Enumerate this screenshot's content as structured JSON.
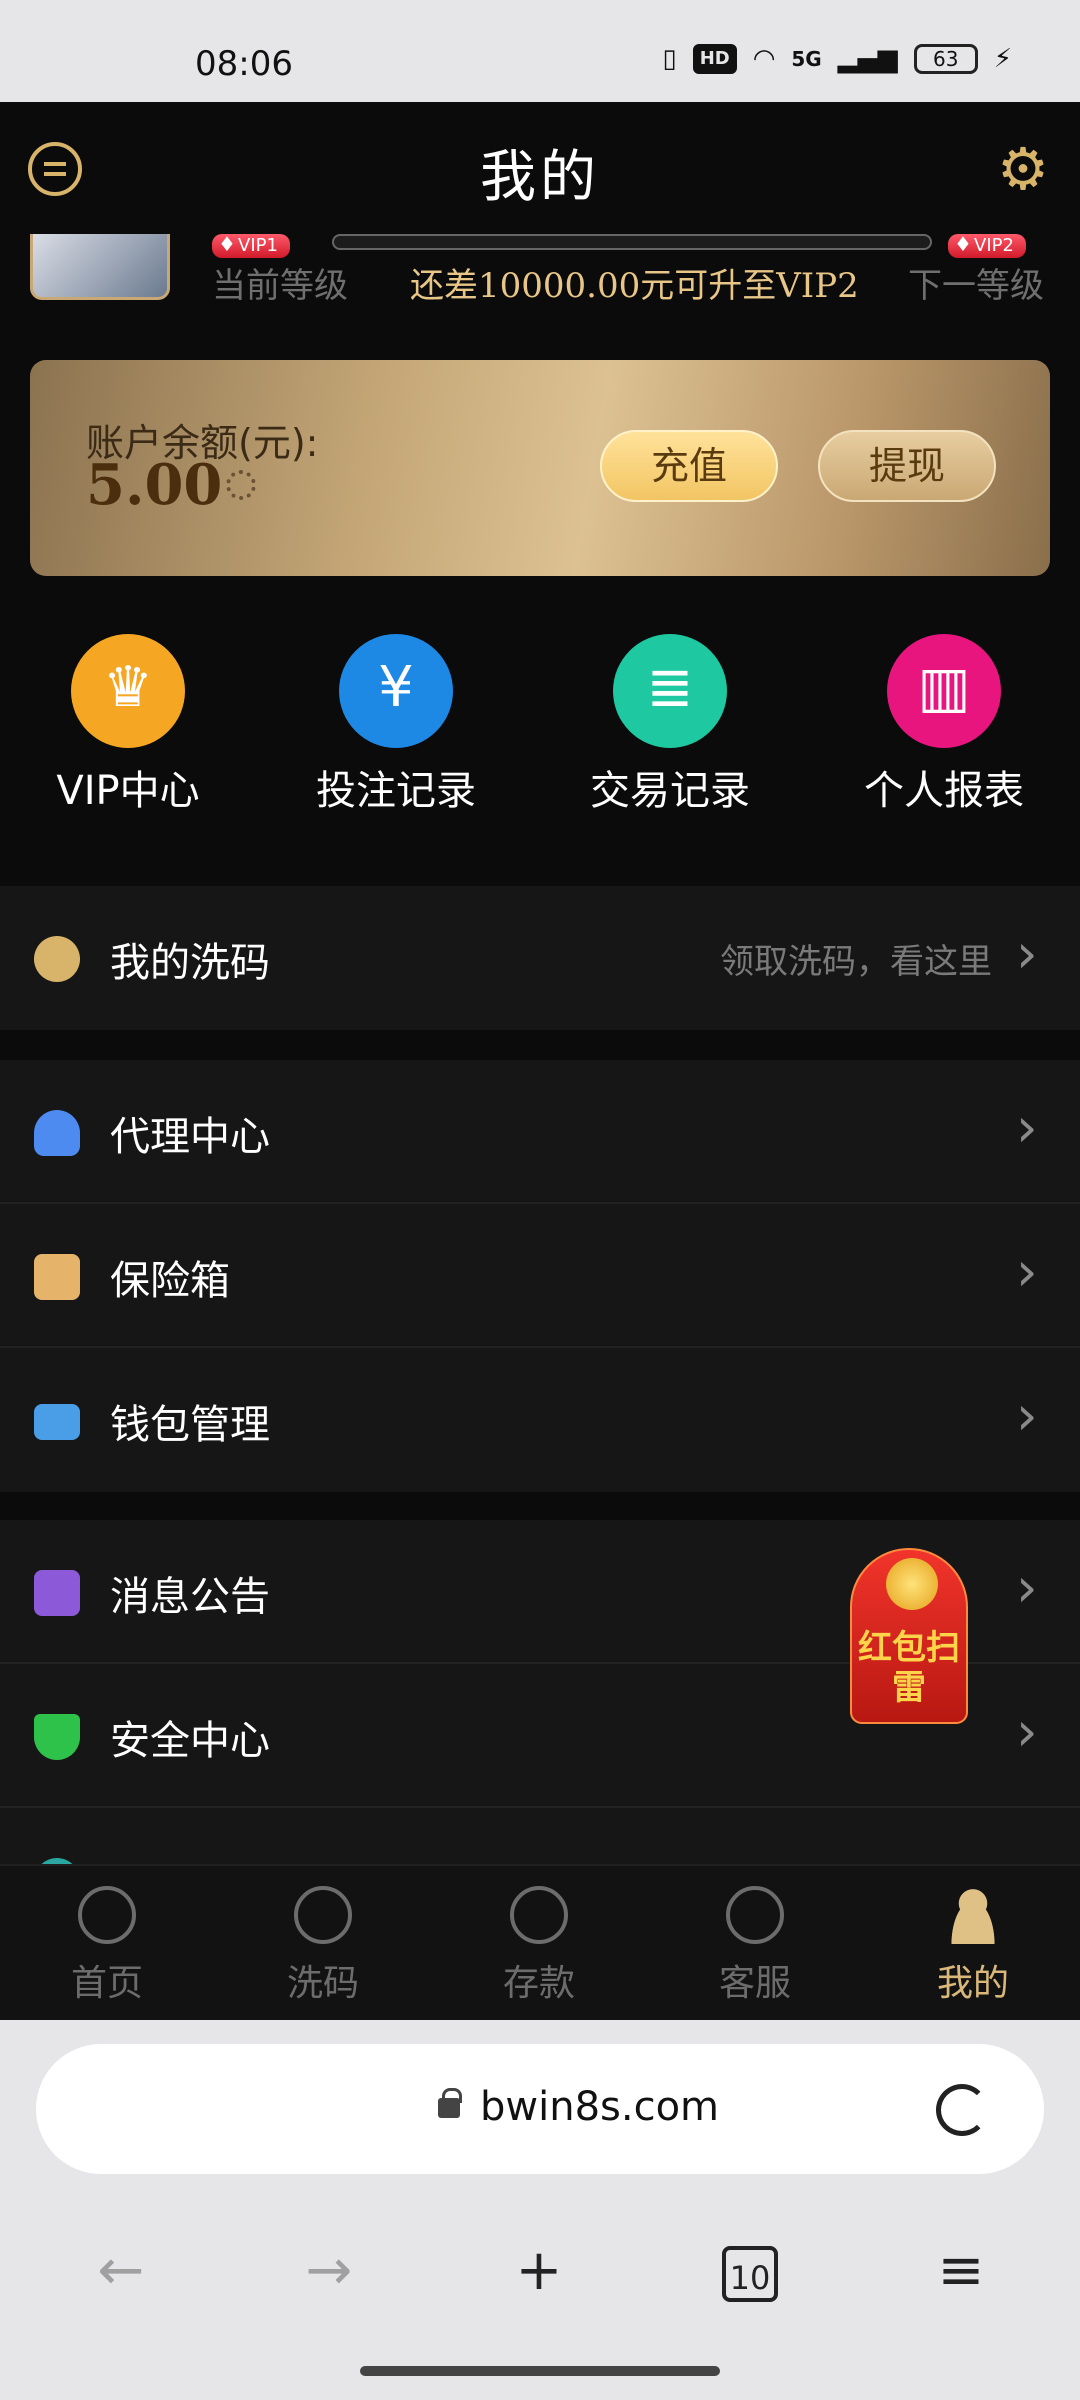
{
  "status_bar": {
    "time": "08:06",
    "network": "5G",
    "hd": "HD",
    "battery": "63"
  },
  "header": {
    "title": "我的"
  },
  "vip": {
    "current_badge": "VIP1",
    "next_badge": "VIP2",
    "current_label": "当前等级",
    "next_label": "下一等级",
    "upgrade_text": "还差10000.00元可升至VIP2",
    "progress": 0
  },
  "balance": {
    "label": "账户余额(元):",
    "amount": "5.00",
    "recharge_label": "充值",
    "withdraw_label": "提现"
  },
  "quick_entries": [
    {
      "label": "VIP中心",
      "icon": "crown-icon",
      "color": "#f5a623"
    },
    {
      "label": "投注记录",
      "icon": "coins-icon",
      "color": "#1e88e5"
    },
    {
      "label": "交易记录",
      "icon": "receipt-icon",
      "color": "#1ec8a0"
    },
    {
      "label": "个人报表",
      "icon": "chart-icon",
      "color": "#e9157f"
    }
  ],
  "menu": {
    "wash": {
      "label": "我的洗码",
      "hint": "领取洗码，看这里"
    },
    "agent": {
      "label": "代理中心"
    },
    "safe": {
      "label": "保险箱"
    },
    "wallet": {
      "label": "钱包管理"
    },
    "notice": {
      "label": "消息公告"
    },
    "security": {
      "label": "安全中心"
    }
  },
  "red_packet": {
    "text": "红包扫雷"
  },
  "bottom_nav": [
    {
      "label": "首页",
      "icon": "home-icon"
    },
    {
      "label": "洗码",
      "icon": "wash-icon"
    },
    {
      "label": "存款",
      "icon": "deposit-icon"
    },
    {
      "label": "客服",
      "icon": "support-icon"
    },
    {
      "label": "我的",
      "icon": "profile-icon",
      "active": true
    }
  ],
  "browser": {
    "url": "bwin8s.com",
    "tab_count": "10"
  }
}
